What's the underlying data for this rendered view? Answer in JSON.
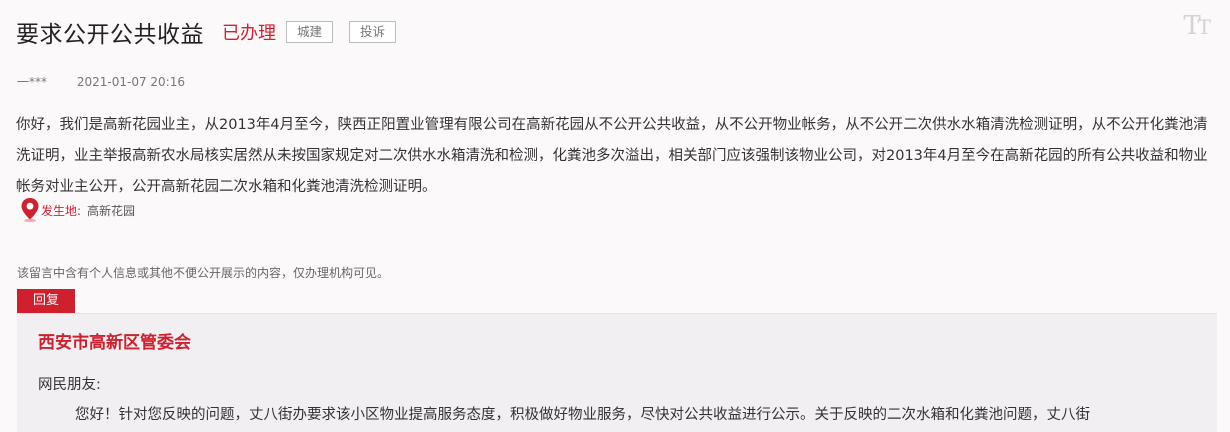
{
  "header": {
    "title": "要求公开公共收益",
    "status": "已办理",
    "tags": [
      "城建",
      "投诉"
    ],
    "font_toggle_big": "T",
    "font_toggle_small": "T"
  },
  "meta": {
    "author": "一***",
    "time": "2021-01-07 20:16"
  },
  "content": "你好，我们是高新花园业主，从2013年4月至今，陕西正阳置业管理有限公司在高新花园从不公开公共收益，从不公开物业帐务，从不公开二次供水水箱清洗检测证明，从不公开化粪池清洗证明，业主举报高新农水局核实居然从未按国家规定对二次供水水箱清洗和检测，化粪池多次溢出，相关部门应该强制该物业公司，对2013年4月至今在高新花园的所有公共收益和物业帐务对业主公开，公开高新花园二次水箱和化粪池清洗检测证明。",
  "location": {
    "label": "发生地:",
    "value": "高新花园"
  },
  "privacy_notice": "该留言中含有个人信息或其他不便公开展示的内容，仅办理机构可见。",
  "reply": {
    "tab_label": "回复",
    "org": "西安市高新区管委会",
    "greeting": "网民朋友:",
    "body": "您好！针对您反映的问题，丈八街办要求该小区物业提高服务态度，积极做好物业服务，尽快对公共收益进行公示。关于反映的二次水箱和化粪池问题，丈八街"
  },
  "colors": {
    "accent": "#d0202e",
    "background": "#fcf9fb",
    "reply_background": "#f1eff1"
  },
  "icons": {
    "location": "map-pin-icon",
    "font_size": "font-size-toggle-icon"
  }
}
